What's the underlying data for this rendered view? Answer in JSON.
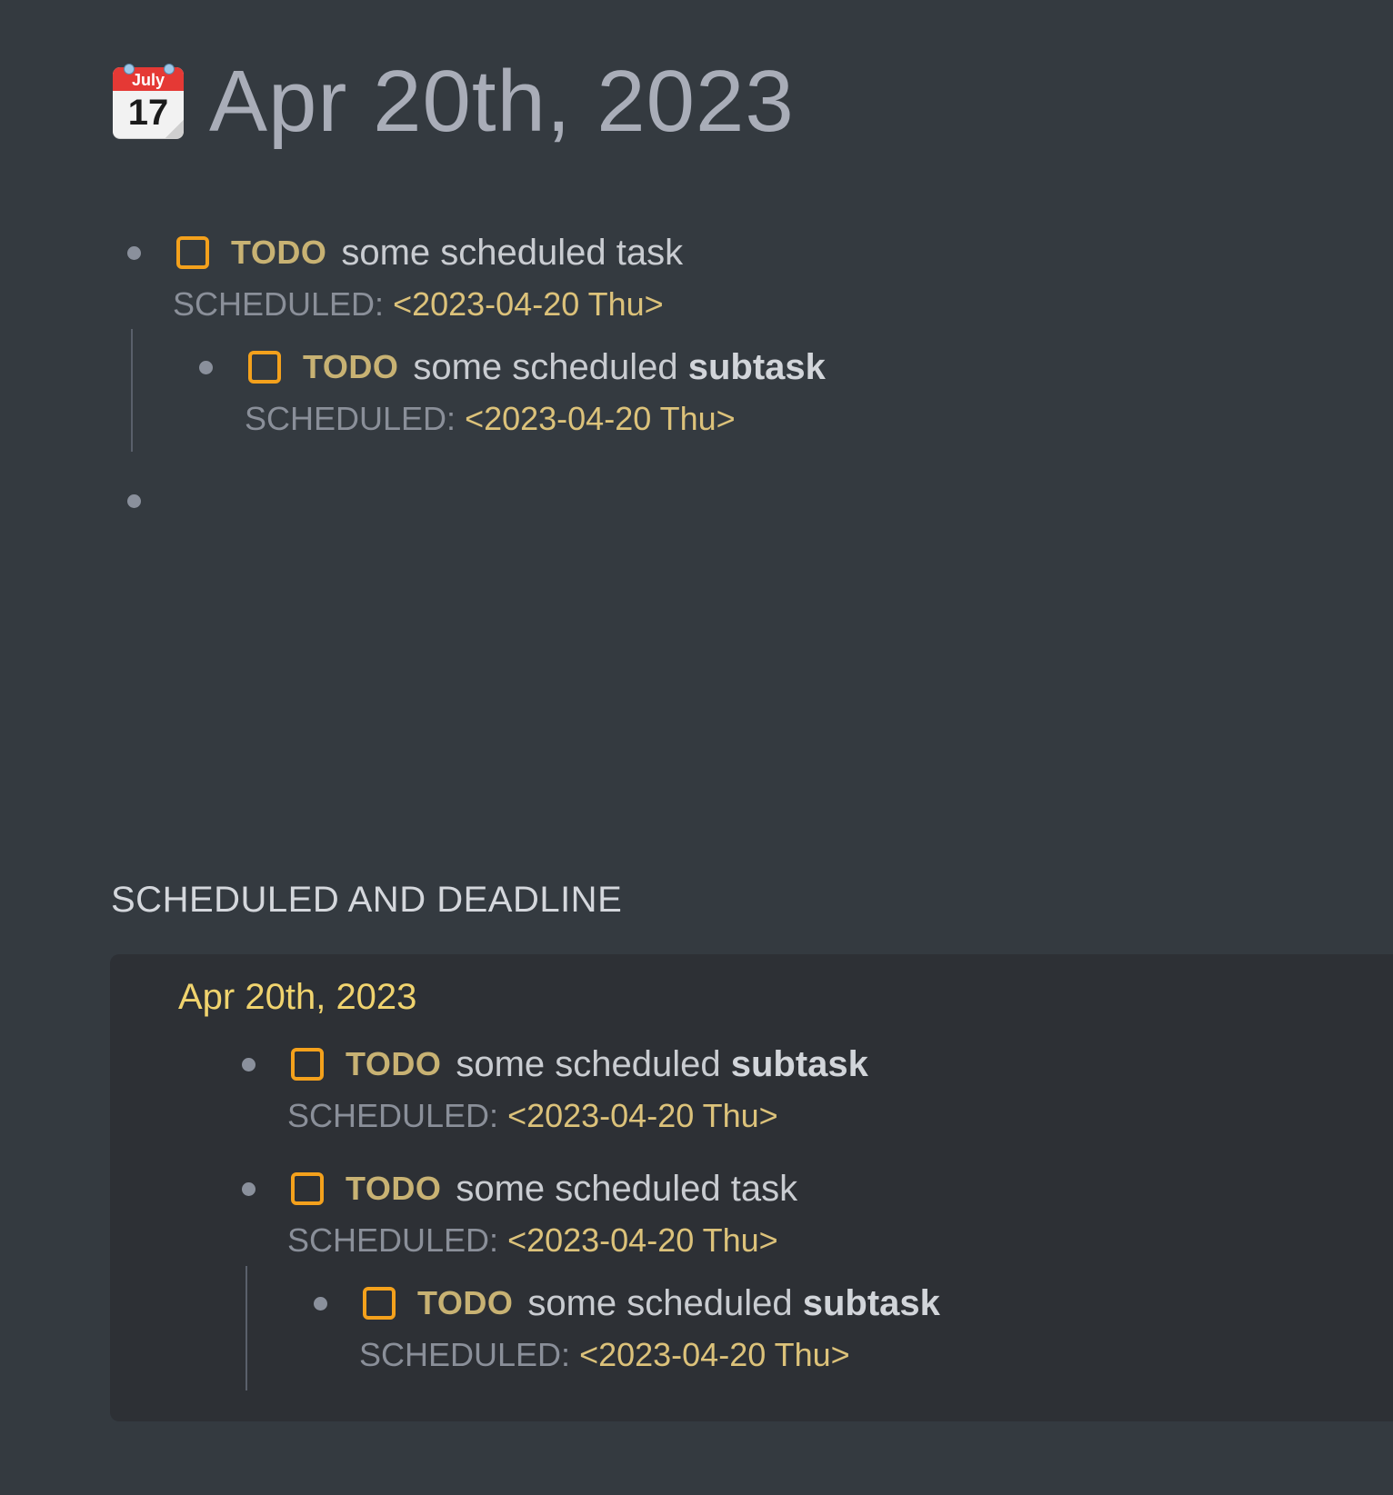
{
  "page": {
    "icon": {
      "name": "calendar-icon",
      "month_text": "July",
      "day_text": "17"
    },
    "title": "Apr 20th, 2023"
  },
  "blocks": [
    {
      "marker": "TODO",
      "text": "some scheduled task",
      "scheduled_label": "SCHEDULED: ",
      "scheduled_date": "<2023-04-20 Thu>",
      "children": [
        {
          "marker": "TODO",
          "text": "some scheduled ",
          "text_bold": "subtask",
          "scheduled_label": "SCHEDULED: ",
          "scheduled_date": "<2023-04-20 Thu>"
        }
      ]
    },
    {
      "text": ""
    }
  ],
  "scheduled_section": {
    "heading": "SCHEDULED AND DEADLINE",
    "date": "Apr 20th, 2023",
    "items": [
      {
        "marker": "TODO",
        "text": "some scheduled ",
        "text_bold": "subtask",
        "scheduled_label": "SCHEDULED: ",
        "scheduled_date": "<2023-04-20 Thu>"
      },
      {
        "marker": "TODO",
        "text": "some scheduled task",
        "scheduled_label": "SCHEDULED: ",
        "scheduled_date": "<2023-04-20 Thu>",
        "children": [
          {
            "marker": "TODO",
            "text": "some scheduled ",
            "text_bold": "subtask",
            "scheduled_label": "SCHEDULED: ",
            "scheduled_date": "<2023-04-20 Thu>"
          }
        ]
      }
    ]
  },
  "colors": {
    "background": "#343a40",
    "panel": "#2d3035",
    "checkbox_border": "#f4a11c",
    "todo_marker": "#c8b273",
    "scheduled_date": "#dcc27a",
    "section_date": "#f0d36e"
  }
}
